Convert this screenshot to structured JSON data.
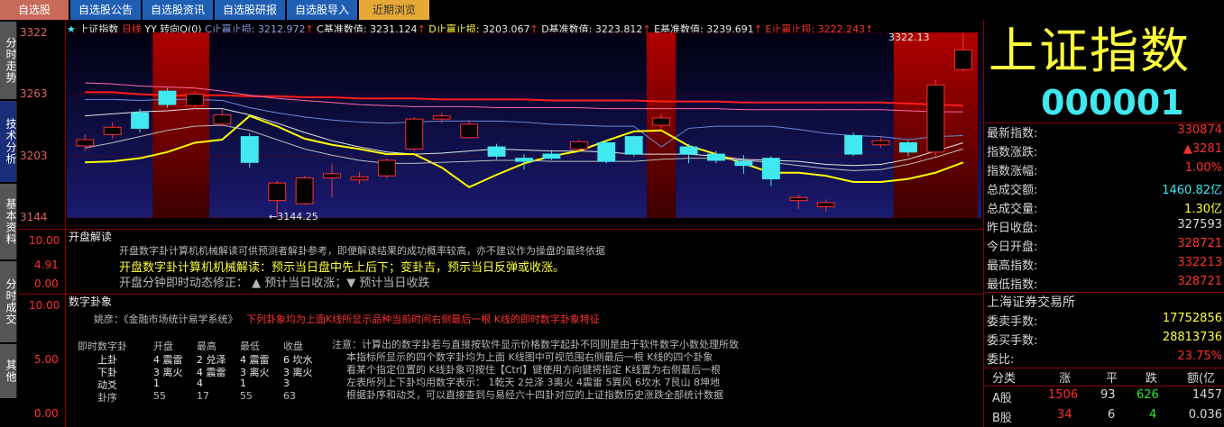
{
  "tabs": [
    "自选股",
    "自选股公告",
    "自选股资讯",
    "自选股研报",
    "自选股导入",
    "近期浏览"
  ],
  "side_tabs": [
    "分时走势",
    "技术分析",
    "基本资料",
    "分时成交",
    "其他"
  ],
  "chart_header": {
    "star": "★",
    "name": "上证指数",
    "period": "日线",
    "indicator": "YY 转向Q(0)",
    "c_stop_label": "C止赢止损:",
    "c_stop_val": "3212.972",
    "c_base_label": "C基准数值:",
    "c_base_val": "3231.124",
    "d_stop_label": "D止赢止损:",
    "d_stop_val": "3203.067",
    "d_base_label": "D基准数值:",
    "d_base_val": "3223.812",
    "e_base_label": "E基准数值:",
    "e_base_val": "3239.691",
    "e_stop_label": "E止赢止损:",
    "e_stop_val": "3222.243",
    "arrow": "↑"
  },
  "y_axis": {
    "labels": [
      "3322",
      "3263",
      "3203",
      "3144"
    ],
    "min": 3144,
    "max": 3322
  },
  "annotations": {
    "high": "3322.13",
    "low": "←3144.25"
  },
  "chart_data": {
    "type": "candlestick",
    "candles": [
      {
        "o": 3213,
        "c": 3219,
        "h": 3224,
        "l": 3208
      },
      {
        "o": 3224,
        "c": 3231,
        "h": 3236,
        "l": 3220
      },
      {
        "o": 3245,
        "c": 3230,
        "h": 3249,
        "l": 3226
      },
      {
        "o": 3266,
        "c": 3253,
        "h": 3269,
        "l": 3250
      },
      {
        "o": 3252,
        "c": 3263,
        "h": 3266,
        "l": 3248
      },
      {
        "o": 3234,
        "c": 3243,
        "h": 3248,
        "l": 3232
      },
      {
        "o": 3222,
        "c": 3197,
        "h": 3225,
        "l": 3192
      },
      {
        "o": 3160,
        "c": 3177,
        "h": 3179,
        "l": 3144
      },
      {
        "o": 3157,
        "c": 3182,
        "h": 3184,
        "l": 3156
      },
      {
        "o": 3182,
        "c": 3186,
        "h": 3196,
        "l": 3163
      },
      {
        "o": 3180,
        "c": 3183,
        "h": 3188,
        "l": 3176
      },
      {
        "o": 3184,
        "c": 3199,
        "h": 3201,
        "l": 3182
      },
      {
        "o": 3210,
        "c": 3239,
        "h": 3241,
        "l": 3208
      },
      {
        "o": 3239,
        "c": 3242,
        "h": 3245,
        "l": 3235
      },
      {
        "o": 3221,
        "c": 3234,
        "h": 3238,
        "l": 3220
      },
      {
        "o": 3212,
        "c": 3203,
        "h": 3215,
        "l": 3200
      },
      {
        "o": 3201,
        "c": 3198,
        "h": 3205,
        "l": 3190
      },
      {
        "o": 3205,
        "c": 3201,
        "h": 3209,
        "l": 3199
      },
      {
        "o": 3210,
        "c": 3217,
        "h": 3219,
        "l": 3208
      },
      {
        "o": 3216,
        "c": 3198,
        "h": 3219,
        "l": 3196
      },
      {
        "o": 3222,
        "c": 3205,
        "h": 3223,
        "l": 3203
      },
      {
        "o": 3233,
        "c": 3240,
        "h": 3244,
        "l": 3230
      },
      {
        "o": 3212,
        "c": 3205,
        "h": 3215,
        "l": 3196
      },
      {
        "o": 3205,
        "c": 3199,
        "h": 3208,
        "l": 3196
      },
      {
        "o": 3198,
        "c": 3194,
        "h": 3204,
        "l": 3186
      },
      {
        "o": 3201,
        "c": 3181,
        "h": 3203,
        "l": 3174
      },
      {
        "o": 3160,
        "c": 3163,
        "h": 3166,
        "l": 3152
      },
      {
        "o": 3154,
        "c": 3158,
        "h": 3161,
        "l": 3149
      },
      {
        "o": 3223,
        "c": 3205,
        "h": 3226,
        "l": 3203
      },
      {
        "o": 3214,
        "c": 3218,
        "h": 3222,
        "l": 3211
      },
      {
        "o": 3216,
        "c": 3207,
        "h": 3218,
        "l": 3203
      },
      {
        "o": 3207,
        "c": 3272,
        "h": 3277,
        "l": 3203
      },
      {
        "o": 3287,
        "c": 3306,
        "h": 3322,
        "l": 3285
      }
    ],
    "lines": [
      {
        "name": "red",
        "color": "#ff1c1c",
        "values": [
          3265,
          3265,
          3263,
          3262,
          3262,
          3262,
          3261,
          3261,
          3260,
          3260,
          3259,
          3259,
          3259,
          3258,
          3258,
          3258,
          3258,
          3257,
          3257,
          3257,
          3257,
          3256,
          3256,
          3256,
          3255,
          3255,
          3255,
          3255,
          3255,
          3255,
          3254,
          3253,
          3252
        ]
      },
      {
        "name": "pink",
        "color": "#ff6aa8",
        "values": [
          3274,
          3273,
          3271,
          3270,
          3269,
          3266,
          3262,
          3259,
          3257,
          3255,
          3253,
          3252,
          3251,
          3251,
          3251,
          3250,
          3250,
          3250,
          3250,
          3249,
          3249,
          3249,
          3249,
          3249,
          3248,
          3248,
          3248,
          3248,
          3248,
          3248,
          3247,
          3246,
          3246
        ]
      },
      {
        "name": "blue",
        "color": "#6a8ad8",
        "values": [
          3258,
          3258,
          3257,
          3258,
          3258,
          3257,
          3250,
          3245,
          3241,
          3238,
          3236,
          3235,
          3236,
          3237,
          3237,
          3237,
          3236,
          3234,
          3233,
          3232,
          3232,
          3212,
          3230,
          3232,
          3232,
          3232,
          3229,
          3225,
          3223,
          3222,
          3219,
          3222,
          3223
        ]
      },
      {
        "name": "white",
        "color": "#e6e6e6",
        "values": [
          3242,
          3244,
          3246,
          3247,
          3249,
          3249,
          3243,
          3235,
          3226,
          3218,
          3212,
          3207,
          3205,
          3206,
          3208,
          3210,
          3209,
          3208,
          3208,
          3207,
          3205,
          3205,
          3205,
          3203,
          3200,
          3199,
          3198,
          3195,
          3194,
          3195,
          3200,
          3208,
          3216
        ]
      },
      {
        "name": "yellow",
        "color": "#ffff00",
        "values": [
          3197,
          3198,
          3201,
          3207,
          3216,
          3219,
          3242,
          3232,
          3220,
          3214,
          3210,
          3205,
          3205,
          3192,
          3173,
          3185,
          3196,
          3203,
          3208,
          3218,
          3227,
          3228,
          3213,
          3205,
          3196,
          3187,
          3187,
          3184,
          3178,
          3178,
          3181,
          3187,
          3197
        ]
      },
      {
        "name": "thin-white",
        "color": "#bbbbbb",
        "values": [
          3211,
          3216,
          3222,
          3228,
          3232,
          3233,
          3228,
          3219,
          3210,
          3204,
          3199,
          3196,
          3196,
          3197,
          3198,
          3199,
          3199,
          3198,
          3198,
          3198,
          3198,
          3200,
          3201,
          3201,
          3199,
          3197,
          3194,
          3191,
          3189,
          3190,
          3195,
          3202,
          3210
        ]
      }
    ]
  },
  "panel1": {
    "scale": [
      "10.00",
      "4.91",
      "0.00"
    ],
    "title": "开盘解读",
    "line1": "开盘数字卦计算机机械解读可供预测者解卦参考，即便解读结果的成功概率较高，亦不建议作为操盘的最终依据",
    "line2": "开盘数字卦计算机机械解读：预示当日盘中先上后下；变卦吉，预示当日反弹或收涨。",
    "line3": "开盘分钟即时动态修正：  ▲ 预计当日收涨；▼ 预计当日收跌"
  },
  "panel2": {
    "scale": [
      "10.00",
      "5.00",
      "0.00"
    ],
    "title": "数字卦象",
    "intro_gray": "姚彦：《金融市场统计易学系统》",
    "intro_red": "下列卦象均为上面K线所显示品种当前时间右侧最后一根 K线的即时数字卦象特征",
    "headers": [
      "即时数字卦",
      "开盘",
      "最高",
      "最低",
      "收盘"
    ],
    "rows": [
      [
        "上卦",
        "4 震雷",
        "2 兑泽",
        "4 震雷",
        "6 坎水"
      ],
      [
        "下卦",
        "3 离火",
        "4 震雷",
        "3 离火",
        "3 离火"
      ],
      [
        "动爻",
        "1",
        "4",
        "1",
        "3"
      ],
      [
        "卦序",
        "55",
        "17",
        "55",
        "63"
      ]
    ],
    "note": [
      "注意：计算出的数字卦若与直接按软件显示价格数字起卦不同则是由于软件数字小数处理所致",
      "本指标所显示的四个数字卦均为上面 K线图中可视范围右侧最后一根 K线的四个卦象",
      "看某个指定位置的 K线卦象可按住【Ctrl】键使用方向键将指定 K线置为右侧最后一根",
      "左表所列上下卦均用数字表示：  1乾天 2兑泽 3离火 4震雷 5巽风 6坎水 7艮山 8坤地",
      "根据卦序和动爻，可以直接查到与易经六十四卦对应的上证指数历史涨跌全部统计数据"
    ]
  },
  "right": {
    "title": "上证指数",
    "code": "000001",
    "rows": [
      {
        "label": "最新指数:",
        "value": "330874",
        "color": "#ff3030"
      },
      {
        "label": "指数涨跌:",
        "value": "▲3281",
        "color": "#ff3030"
      },
      {
        "label": "指数涨幅:",
        "value": "1.00%",
        "color": "#ff3030"
      },
      {
        "label": "总成交额:",
        "value": "1460.82亿",
        "color": "#40e8f0"
      },
      {
        "label": "总成交量:",
        "value": "1.30亿",
        "color": "#ffff3c"
      },
      {
        "label": "昨日收盘:",
        "value": "327593",
        "color": "#d8d8d8"
      },
      {
        "label": "今日开盘:",
        "value": "328721",
        "color": "#ff3030"
      },
      {
        "label": "最高指数:",
        "value": "332213",
        "color": "#ff3030"
      },
      {
        "label": "最低指数:",
        "value": "328721",
        "color": "#ff3030"
      }
    ],
    "exchange": "上海证券交易所",
    "rows2": [
      {
        "label": "委卖手数:",
        "value": "17752856",
        "color": "#ffff3c"
      },
      {
        "label": "委买手数:",
        "value": "28813736",
        "color": "#ffff3c"
      },
      {
        "label": "委比:",
        "value": "23.75%",
        "color": "#ff3030"
      }
    ],
    "table_headers": [
      "分类",
      "涨",
      "平",
      "跌",
      "额(亿"
    ],
    "table_rows": [
      [
        "A股",
        "1506",
        "93",
        "626",
        "1457"
      ],
      [
        "B股",
        "34",
        "6",
        "4",
        "0.036"
      ]
    ]
  },
  "colors": {
    "bg": "#000000",
    "grid": "#8a0000",
    "up": "#ff3030",
    "down": "#40e8f0",
    "tab": "#1e5fb4"
  }
}
